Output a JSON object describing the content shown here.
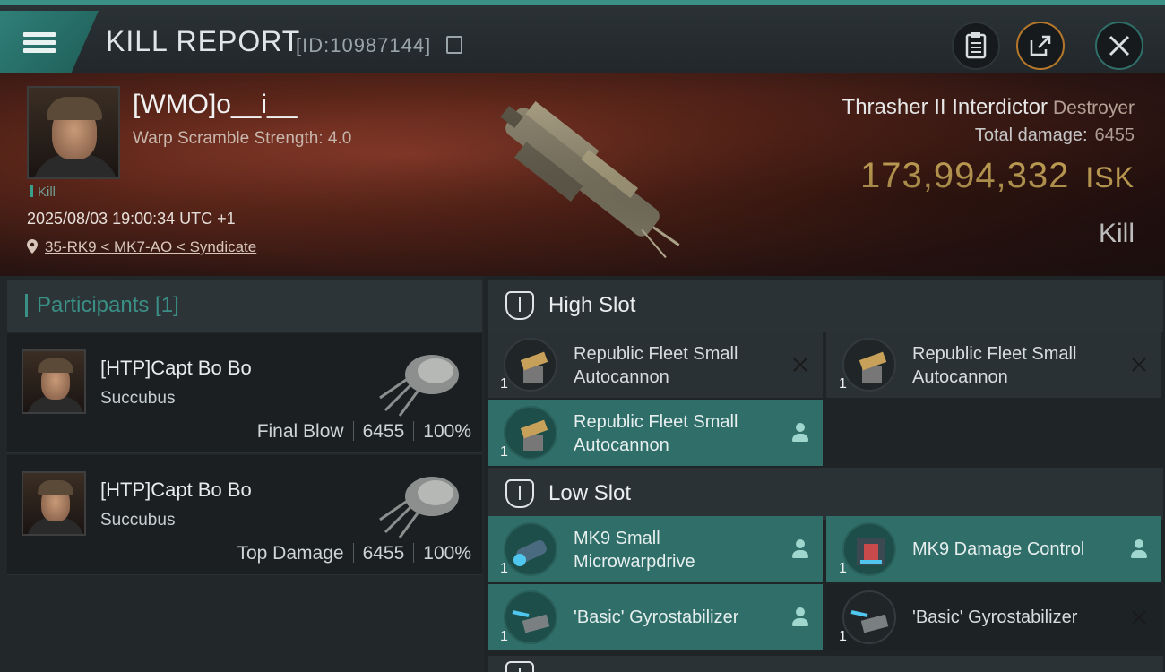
{
  "header": {
    "title": "KILL REPORT",
    "report_id": "[ID:10987144]"
  },
  "victim": {
    "name": "[WMO]o__i__",
    "subtitle": "Warp Scramble Strength: 4.0",
    "tag": "Kill",
    "datetime": "2025/08/03 19:00:34 UTC +1",
    "location": "35-RK9 < MK7-AO < Syndicate",
    "ship_name": "Thrasher II Interdictor",
    "ship_class": "Destroyer",
    "total_damage_label": "Total damage:",
    "total_damage": "6455",
    "isk_value": "173,994,332",
    "isk_unit": "ISK",
    "result": "Kill"
  },
  "participants": {
    "title": "Participants [1]",
    "items": [
      {
        "name": "[HTP]Capt Bo Bo",
        "ship": "Succubus",
        "label": "Final Blow",
        "damage": "6455",
        "percent": "100%"
      },
      {
        "name": "[HTP]Capt Bo Bo",
        "ship": "Succubus",
        "label": "Top Damage",
        "damage": "6455",
        "percent": "100%"
      }
    ]
  },
  "fitting": {
    "high_slot": {
      "title": "High Slot",
      "modules": [
        {
          "name": "Republic Fleet Small Autocannon",
          "qty": "1",
          "status": "destroyed"
        },
        {
          "name": "Republic Fleet Small Autocannon",
          "qty": "1",
          "status": "destroyed"
        },
        {
          "name": "Republic Fleet Small Autocannon",
          "qty": "1",
          "status": "dropped"
        }
      ]
    },
    "low_slot": {
      "title": "Low Slot",
      "modules": [
        {
          "name": "MK9 Small Microwarpdrive",
          "qty": "1",
          "status": "dropped"
        },
        {
          "name": "MK9 Damage Control",
          "qty": "1",
          "status": "dropped"
        },
        {
          "name": "'Basic' Gyrostabilizer",
          "qty": "1",
          "status": "dropped"
        },
        {
          "name": "'Basic' Gyrostabilizer",
          "qty": "1",
          "status": "destroyed"
        }
      ]
    }
  },
  "colors": {
    "accent": "#3a8f86",
    "isk": "#f2c86a",
    "dropped_bg": "#2f6e69"
  },
  "icons": {
    "menu": "hamburger-icon",
    "report": "clipboard-icon",
    "share": "share-icon",
    "close": "close-icon",
    "destroyed": "x-icon",
    "dropped": "person-icon",
    "location": "pin-icon"
  }
}
